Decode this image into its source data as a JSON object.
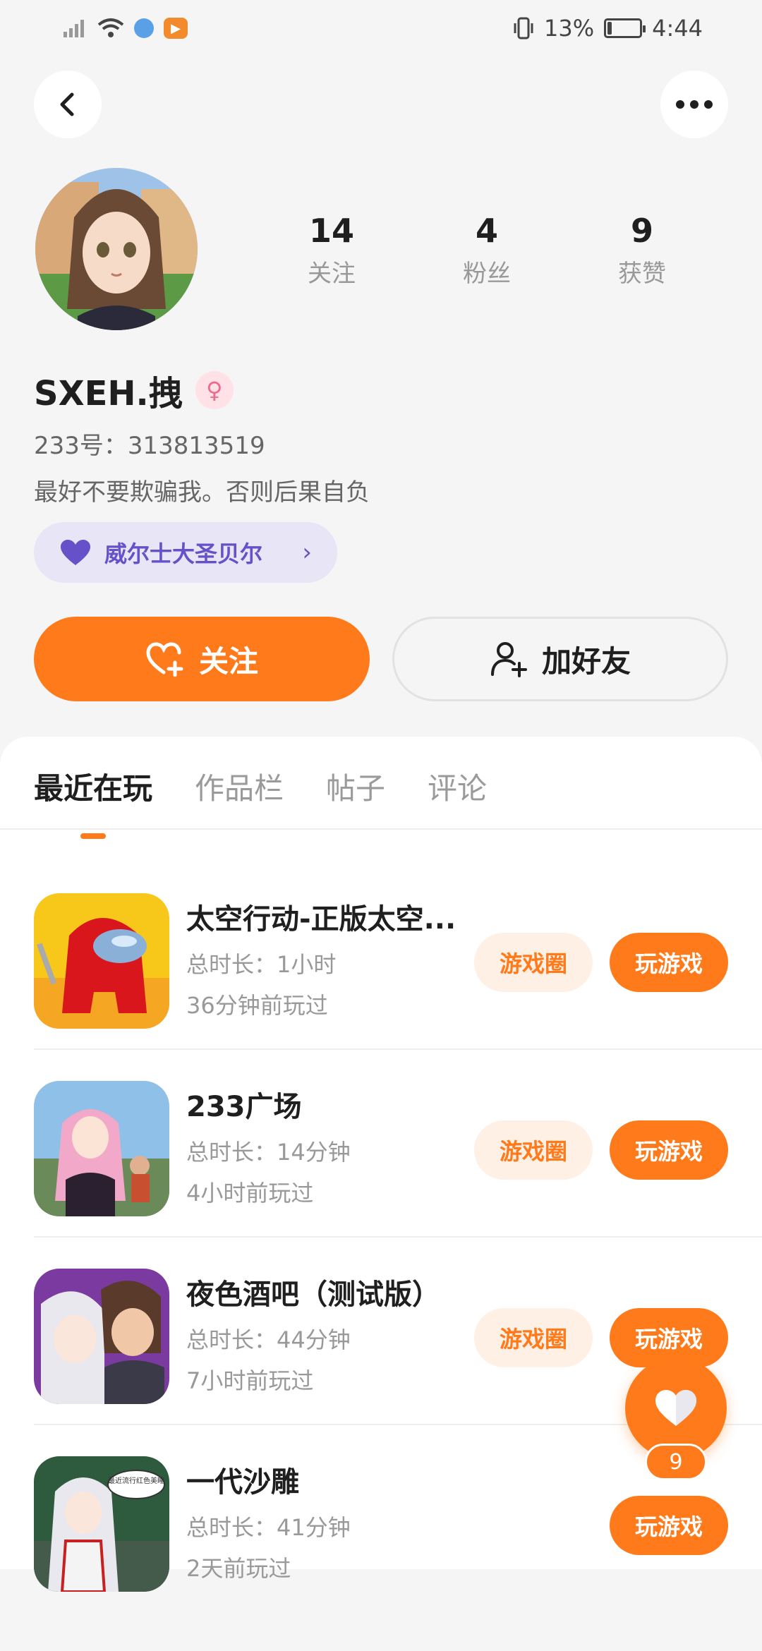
{
  "status_bar": {
    "battery": "13%",
    "battery_level": 0.13,
    "time": "4:44",
    "icons": [
      "signal-icon",
      "wifi-icon",
      "globe-icon",
      "app-icon",
      "vibrate-icon",
      "battery-icon"
    ]
  },
  "header": {
    "back_icon": "chevron-left-icon",
    "more_icon": "more-dots-icon"
  },
  "profile": {
    "stats": [
      {
        "value": "14",
        "label": "关注"
      },
      {
        "value": "4",
        "label": "粉丝"
      },
      {
        "value": "9",
        "label": "获赞"
      }
    ],
    "username": "SXEH.拽",
    "gender_icon": "female-icon",
    "uid": "233号：313813519",
    "bio": "最好不要欺骗我。否则后果自负",
    "tag": {
      "icon": "heart-icon",
      "label": "威尔士大圣贝尔"
    }
  },
  "actions": {
    "follow_label": "关注",
    "add_friend_label": "加好友"
  },
  "tabs": [
    {
      "label": "最近在玩",
      "active": true
    },
    {
      "label": "作品栏",
      "active": false
    },
    {
      "label": "帖子",
      "active": false
    },
    {
      "label": "评论",
      "active": false
    }
  ],
  "games": [
    {
      "title": "太空行动-正版太空...",
      "duration": "总时长：1小时",
      "last_played": "36分钟前玩过",
      "circle_label": "游戏圈",
      "play_label": "玩游戏"
    },
    {
      "title": "233广场",
      "duration": "总时长：14分钟",
      "last_played": "4小时前玩过",
      "circle_label": "游戏圈",
      "play_label": "玩游戏"
    },
    {
      "title": "夜色酒吧（测试版）",
      "duration": "总时长：44分钟",
      "last_played": "7小时前玩过",
      "circle_label": "游戏圈",
      "play_label": "玩游戏"
    },
    {
      "title": "一代沙雕",
      "duration": "总时长：41分钟",
      "last_played": "2天前玩过",
      "play_label": "玩游戏",
      "icon_caption": "最近流行红色美睡"
    }
  ],
  "fab": {
    "icon": "heart-icon",
    "count": "9"
  },
  "colors": {
    "accent": "#ff7a1a",
    "tag_bg": "#e7e5f6",
    "tag_text": "#6651c9"
  }
}
